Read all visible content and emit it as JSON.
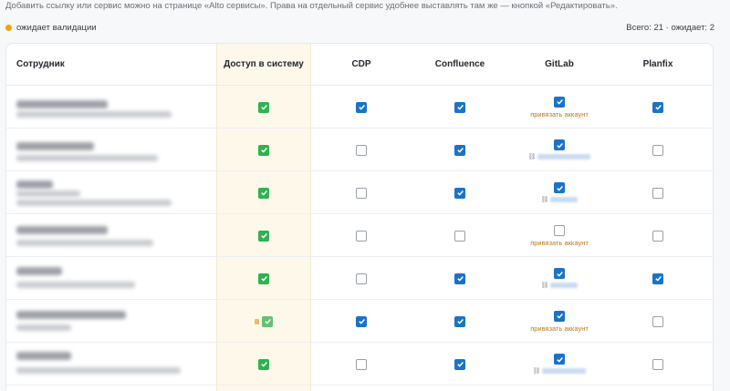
{
  "hint_text": "Добавить ссылку или сервис можно на странице «Alto сервисы». Права на отдельный сервис удобнее выставлять там же — кнопкой «Редактировать».",
  "legend": {
    "label": "ожидает валидации",
    "dot_color": "#f0a500"
  },
  "totals": "Всего: 21 · ожидает: 2",
  "columns": {
    "employee": "Сотрудник",
    "access": "Доступ в систему",
    "cdp": "CDP",
    "confluence": "Confluence",
    "gitlab": "GitLab",
    "planfix": "Planfix"
  },
  "gitlab_link_note": "привязать аккаунт",
  "colors": {
    "checkbox_on": "#1a73c8",
    "access_on": "#2fb24f",
    "highlight_column": "#fdf8ea",
    "link_note": "#b7791f"
  }
}
